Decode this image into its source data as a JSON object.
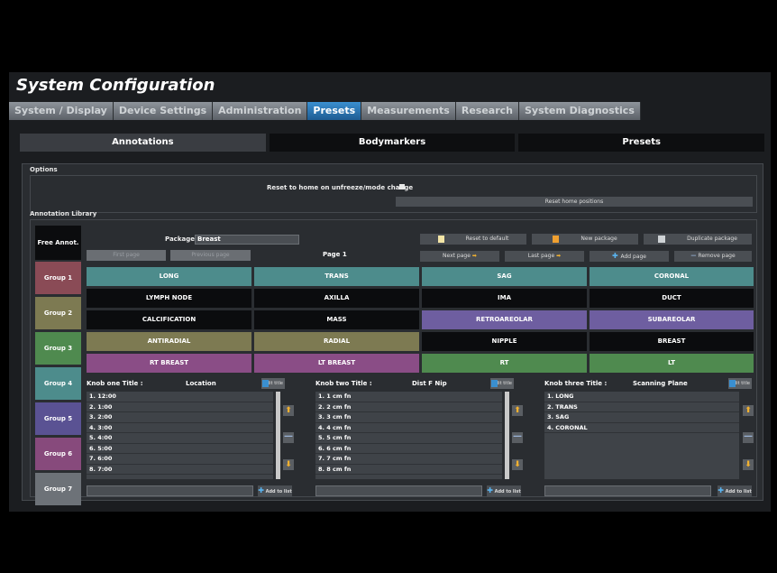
{
  "app": {
    "title": "System Configuration"
  },
  "tabs": [
    "System / Display",
    "Device Settings",
    "Administration",
    "Presets",
    "Measurements",
    "Research",
    "System Diagnostics"
  ],
  "active_tab": "Presets",
  "subtabs": [
    "Annotations",
    "Bodymarkers",
    "Presets"
  ],
  "active_subtab": "Annotations",
  "options": {
    "label": "Options",
    "reset_label": "Reset to home on unfreeze/mode change",
    "reset_checked": true,
    "reset_home_button": "Reset home positions"
  },
  "library": {
    "label": "Annotation Library",
    "free_annot": "Free Annot.",
    "groups": [
      "Group 1",
      "Group 2",
      "Group 3",
      "Group 4",
      "Group 5",
      "Group 6",
      "Group 7"
    ],
    "package_label": "Package",
    "package_value": "Breast",
    "first_page": "First page",
    "previous_page": "Previous page",
    "page_label": "Page 1",
    "buttons": {
      "reset_default": "Reset to default",
      "new_package": "New package",
      "duplicate_package": "Duplicate package",
      "next_page": "Next page",
      "last_page": "Last page",
      "add_page": "Add page",
      "remove_page": "Remove page"
    },
    "annotations": [
      [
        "LONG",
        "TRANS",
        "SAG",
        "CORONAL"
      ],
      [
        "LYMPH NODE",
        "AXILLA",
        "IMA",
        "DUCT"
      ],
      [
        "CALCIFICATION",
        "MASS",
        "RETROAREOLAR",
        "SUBAREOLAR"
      ],
      [
        "ANTIRADIAL",
        "RADIAL",
        "NIPPLE",
        "BREAST"
      ],
      [
        "RT BREAST",
        "LT BREAST",
        "RT",
        "LT"
      ]
    ],
    "colors": {
      "teal": "#4d8c8c",
      "black": "#0b0c0e",
      "olive": "#7d7a52",
      "purple": "#6e5ea0",
      "magenta": "#8a4d86",
      "green": "#4f8a4f",
      "group1": "#8a4b56",
      "group2": "#7d7a52",
      "group3": "#4f8a4f",
      "group4": "#4d8c8c",
      "group5": "#5a5293",
      "group6": "#874a7c",
      "group7": "#6d7278"
    }
  },
  "knobs": [
    {
      "title": "Knob one Title :",
      "value": "Location",
      "edit": "Edit title",
      "items": [
        "1. 12:00",
        "2. 1:00",
        "3. 2:00",
        "4. 3:00",
        "5. 4:00",
        "6. 5:00",
        "7. 6:00",
        "8. 7:00"
      ],
      "add": "Add to list"
    },
    {
      "title": "Knob two Title :",
      "value": "Dist F Nip",
      "edit": "Edit title",
      "items": [
        "1. 1 cm fn",
        "2. 2 cm fn",
        "3. 3 cm fn",
        "4. 4 cm fn",
        "5. 5 cm fn",
        "6. 6 cm fn",
        "7. 7 cm fn",
        "8. 8 cm fn"
      ],
      "add": "Add to list"
    },
    {
      "title": "Knob three Title :",
      "value": "Scanning Plane",
      "edit": "Edit title",
      "items": [
        "1. LONG",
        "2. TRANS",
        "3. SAG",
        "4. CORONAL"
      ],
      "add": "Add to list"
    }
  ]
}
